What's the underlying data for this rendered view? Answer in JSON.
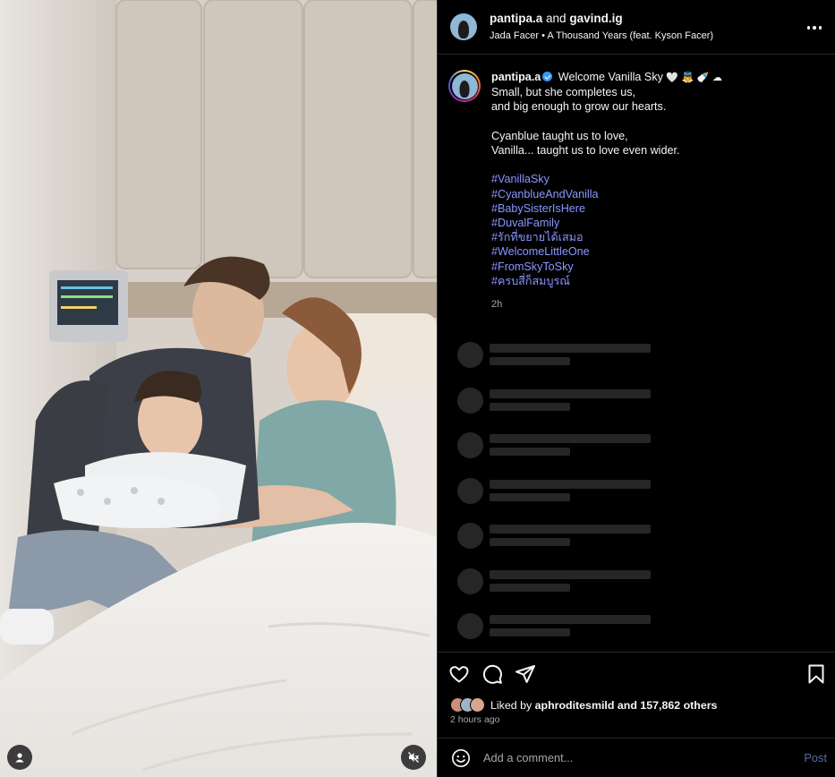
{
  "header": {
    "user1": "pantipa.a",
    "and": "and",
    "user2": "gavind.ig",
    "music": "Jada Facer • A Thousand Years (feat. Kyson Facer)"
  },
  "caption": {
    "username": "pantipa.a",
    "title": "Welcome Vanilla Sky",
    "title_emojis": "🤍 👼 🍼 ☁",
    "lines": [
      "Small, but she completes us,",
      "and big enough to grow our hearts.",
      "",
      "Cyanblue taught us to love,",
      "Vanilla... taught us to love even wider."
    ],
    "hashtags": [
      "#VanillaSky",
      "#CyanblueAndVanilla",
      "#BabySisterIsHere",
      "#DuvalFamily",
      "#รักที่ขยายได้เสมอ",
      "#WelcomeLittleOne",
      "#FromSkyToSky",
      "#ครบสี่ก็สมบูรณ์"
    ],
    "time": "2h"
  },
  "likes": {
    "prefix": "Liked by",
    "user": "aphroditesmild",
    "suffix": "and 157,862 others",
    "ago": "2 hours ago"
  },
  "comment": {
    "placeholder": "Add a comment...",
    "post_label": "Post"
  },
  "icons": {
    "tag": "person-tag-icon",
    "mute": "muted-speaker-icon",
    "more": "more-options-icon",
    "like": "heart-icon",
    "comment": "comment-bubble-icon",
    "share": "paper-plane-icon",
    "save": "bookmark-icon",
    "emoji": "smiley-icon"
  },
  "colors": {
    "background": "#000000",
    "hashtag": "#8b96ff",
    "verified": "#3897f0",
    "post_disabled": "#5a6aa8",
    "muted_text": "#a8a8a8"
  }
}
